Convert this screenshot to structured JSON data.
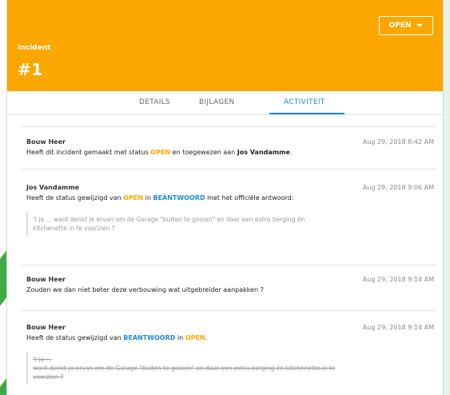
{
  "header": {
    "kind": "Incident",
    "number": "#1",
    "status_button": "OPEN"
  },
  "tabs": [
    "DETAILS",
    "BIJLAGEN",
    "ACTIVITEIT"
  ],
  "active_tab": "ACTIVITEIT",
  "activity": [
    {
      "author": "Bouw Heer",
      "time": "Aug 29, 2018 8:42 AM",
      "msg_a": "Heeft dit incident gemaakt met status ",
      "status": "OPEN",
      "msg_b": " en toegewezen aan ",
      "assignee": "Jos Vandamme",
      "msg_c": "."
    },
    {
      "author": "Jos Vandamme",
      "time": "Aug 29, 2018 9:06 AM",
      "msg_a": "Heeft de status gewijzigd van ",
      "from": "OPEN",
      "msg_b": " in ",
      "to": "BEANTWOORD",
      "msg_c": " met het officiële antwoord:",
      "quote_1": "'t ja ... want denkt je ervan om de Garage \"buiten te gooien\" en daar een extra berging én",
      "quote_2": "kitchenette in te voorzien ?"
    },
    {
      "author": "Bouw Heer",
      "time": "Aug 29, 2018 9:14 AM",
      "msg": "Zouden we dan niet beter deze verbouwing wat uitgebreider aanpakken ?"
    },
    {
      "author": "Bouw Heer",
      "time": "Aug 29, 2018 9:14 AM",
      "msg_a": "Heeft de status gewijzigd van ",
      "from": "BEANTWOORD",
      "msg_b": " in ",
      "to": "OPEN",
      "msg_c": ".",
      "quote_1": "'t ja ...",
      "quote_2": "want denkt je ervan om de Garage \"buiten te gooien\" en daar een extra berging én kitchenette in te",
      "quote_3": "voorzien ?"
    }
  ],
  "colors": {
    "header_bg": "#fca700",
    "accent_blue": "#1a8bd8",
    "status_open": "#fca700",
    "background_green": "#33a83a",
    "marker_red": "#d9232d"
  }
}
